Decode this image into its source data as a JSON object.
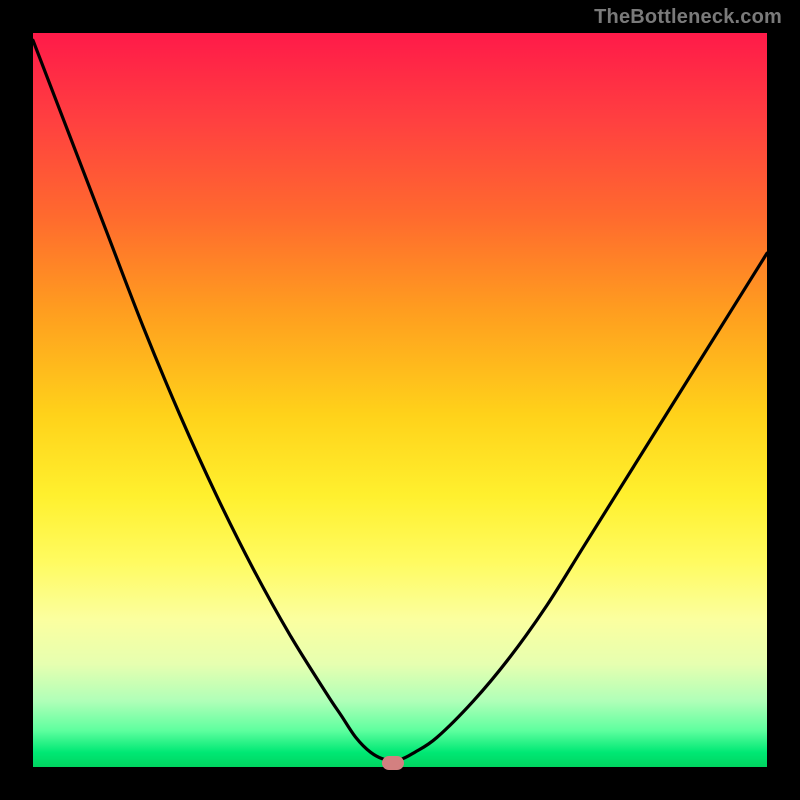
{
  "watermark": "TheBottleneck.com",
  "colors": {
    "frame": "#000000",
    "curve": "#000000",
    "marker": "#d38080"
  },
  "chart_data": {
    "type": "line",
    "title": "",
    "xlabel": "",
    "ylabel": "",
    "xlim": [
      0,
      100
    ],
    "ylim": [
      0,
      100
    ],
    "x": [
      0,
      5,
      10,
      15,
      20,
      25,
      30,
      35,
      40,
      42,
      44,
      46,
      48,
      50,
      52,
      55,
      60,
      65,
      70,
      75,
      80,
      85,
      90,
      95,
      100
    ],
    "values": [
      99,
      86,
      73,
      60,
      48,
      37,
      27,
      18,
      10,
      7,
      4,
      2,
      1,
      1,
      2,
      4,
      9,
      15,
      22,
      30,
      38,
      46,
      54,
      62,
      70
    ],
    "marker": {
      "x": 49,
      "y": 0.5
    },
    "background_gradient": "red-yellow-green vertical"
  }
}
